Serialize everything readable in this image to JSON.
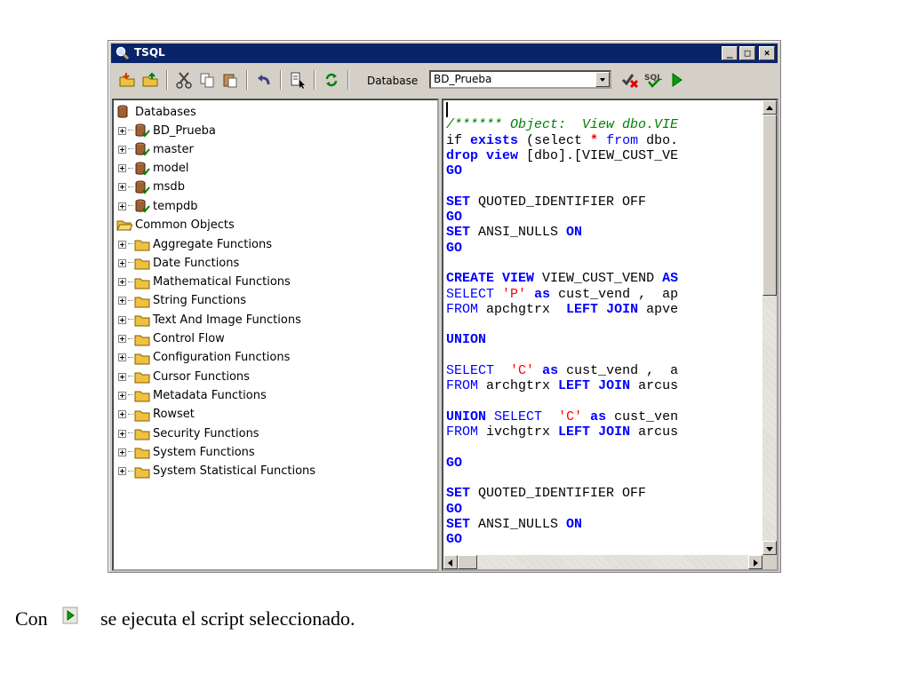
{
  "window": {
    "title": "TSQL",
    "buttons": [
      "_",
      "□",
      "×"
    ]
  },
  "toolbar": {
    "database_label": "Database",
    "database_value": "BD_Prueba",
    "icons": [
      "open-folder-icon",
      "save-folder-icon",
      "cut-icon",
      "copy-icon",
      "paste-icon",
      "undo-icon",
      "select-icon",
      "refresh-icon",
      "check-syntax-icon",
      "sql-icon",
      "run-icon"
    ]
  },
  "tree": {
    "root": "Databases",
    "databases": [
      "BD_Prueba",
      "master",
      "model",
      "msdb",
      "tempdb"
    ],
    "common_root": "Common Objects",
    "common_items": [
      "Aggregate Functions",
      "Date Functions",
      "Mathematical Functions",
      "String Functions",
      "Text And Image Functions",
      "Control Flow",
      "Configuration Functions",
      "Cursor Functions",
      "Metadata Functions",
      "Rowset",
      "Security Functions",
      "System Functions",
      "System Statistical Functions"
    ]
  },
  "editor": {
    "lines": [
      "",
      "/****** Object:  View dbo.VIE",
      "if exists (select * from dbo.",
      "drop view [dbo].[VIEW_CUST_VE",
      "GO",
      "",
      "SET QUOTED_IDENTIFIER OFF",
      "GO",
      "SET ANSI_NULLS ON",
      "GO",
      "",
      "CREATE VIEW VIEW_CUST_VEND AS",
      "SELECT 'P' as cust_vend ,  ap",
      "FROM apchgtrx  LEFT JOIN apve",
      "",
      "UNION",
      "",
      "SELECT  'C' as cust_vend ,  a",
      "FROM archgtrx LEFT JOIN arcus",
      "",
      "UNION SELECT  'C' as cust_ven",
      "FROM ivchgtrx LEFT JOIN arcus",
      "",
      "GO",
      "",
      "SET QUOTED_IDENTIFIER OFF",
      "GO",
      "SET ANSI_NULLS ON",
      "GO"
    ]
  },
  "caption": {
    "before": "Con",
    "after": "se ejecuta el script seleccionado."
  },
  "colors": {
    "titlebar": "#0a246a",
    "keyword": "#0000ff",
    "comment": "#008000",
    "string": "#ff0000"
  }
}
